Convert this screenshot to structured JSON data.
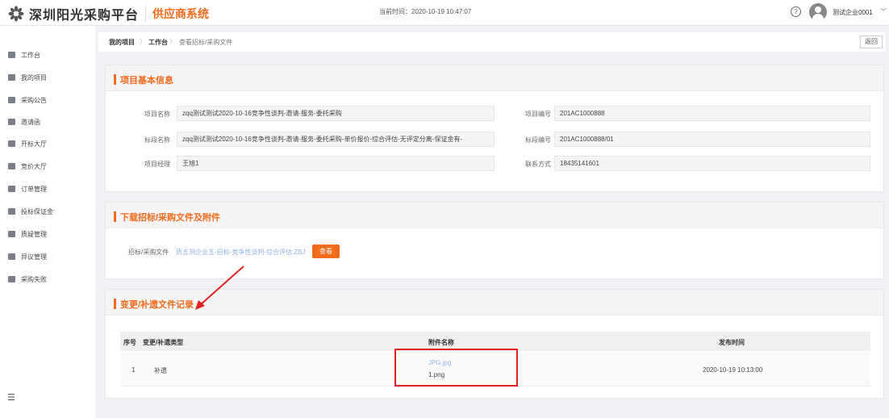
{
  "header": {
    "logo_text": "深圳阳光采购平台",
    "system_name": "供应商系统",
    "current_time": "当前时间：2020-10-19 10:47:07",
    "help_symbol": "?",
    "user_name": "测试企业0001",
    "caret": "﹀",
    "logo_icon": "sunflower-logo",
    "accent_color": "#f26a1b"
  },
  "sidebar": {
    "items": [
      {
        "label": "工作台",
        "icon": "workbench-icon"
      },
      {
        "label": "我的项目",
        "icon": "folder-icon"
      },
      {
        "label": "采购公告",
        "icon": "cart-icon"
      },
      {
        "label": "邀请函",
        "icon": "mail-icon"
      },
      {
        "label": "开标大厅",
        "icon": "bank-icon"
      },
      {
        "label": "竞价大厅",
        "icon": "bid-icon"
      },
      {
        "label": "订单管理",
        "icon": "order-icon"
      },
      {
        "label": "投标保证金",
        "icon": "deposit-icon"
      },
      {
        "label": "质疑管理",
        "icon": "question-icon"
      },
      {
        "label": "异议管理",
        "icon": "objection-icon"
      },
      {
        "label": "采购失败",
        "icon": "fail-icon"
      }
    ],
    "collapse_symbol": "☰"
  },
  "breadcrumb": {
    "items": [
      "我的项目",
      "工作台",
      "查看招标/采购文件"
    ],
    "separator": "〉",
    "back_label": "返回"
  },
  "project_info": {
    "title": "项目基本信息",
    "project_name_label": "项目名称",
    "project_name": "zqq测试测试2020-10-16竞争性谈判-邀请-服务-委托采购",
    "project_no_label": "项目编号",
    "project_no": "201AC1000888",
    "section_name_label": "标段名称",
    "section_name": "zqq测试测试2020-10-16竞争性谈判-邀请-服务-委托采购-单价报价-综合评估-无评定分离-保证金有-",
    "section_no_label": "标段编号",
    "section_no": "201AC1000888/01",
    "manager_label": "项目经理",
    "manager": "王旭1",
    "contact_label": "联系方式",
    "contact": "18435141601"
  },
  "download": {
    "title": "下载招标/采购文件及附件",
    "file_label": "招标/采购文件",
    "file_name": "质五测企业五-招标-竞争性谈判-综合评估.ZBJ",
    "view_button": "查看"
  },
  "changes": {
    "title": "变更/补遗文件记录",
    "columns": [
      "序号",
      "变更/补遗类型",
      "附件名称",
      "发布时间"
    ],
    "rows": [
      {
        "index": "1",
        "type": "补遗",
        "attachment_1": "JPG.jpg",
        "attachment_2": "1.png",
        "time": "2020-10-19 10:13:00"
      }
    ]
  },
  "annotation_color": "#e02020"
}
